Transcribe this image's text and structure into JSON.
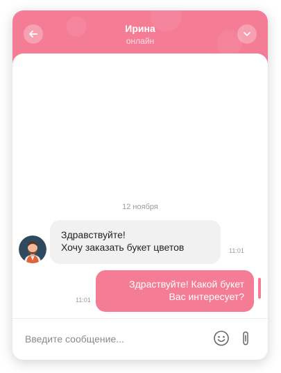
{
  "header": {
    "title": "Ирина",
    "status": "онлайн",
    "back_icon": "arrow-left-icon",
    "collapse_icon": "chevron-down-icon"
  },
  "chat": {
    "date_separator": "12 ноября",
    "messages": [
      {
        "direction": "incoming",
        "lines": [
          "Здравствуйте!",
          "Хочу заказать букет цветов"
        ],
        "time": "11:01",
        "avatar": "user-avatar-icon"
      },
      {
        "direction": "outgoing",
        "lines": [
          "Здраствуйте! Какой букет",
          "Вас интересует?"
        ],
        "time": "11:01"
      }
    ]
  },
  "composer": {
    "placeholder": "Введите сообщение...",
    "value": "",
    "emoji_icon": "smiley-icon",
    "attach_icon": "paperclip-icon"
  },
  "colors": {
    "accent": "#f47c95",
    "incoming_bubble": "#f1f1f1",
    "muted_text": "#9a9a9a"
  }
}
